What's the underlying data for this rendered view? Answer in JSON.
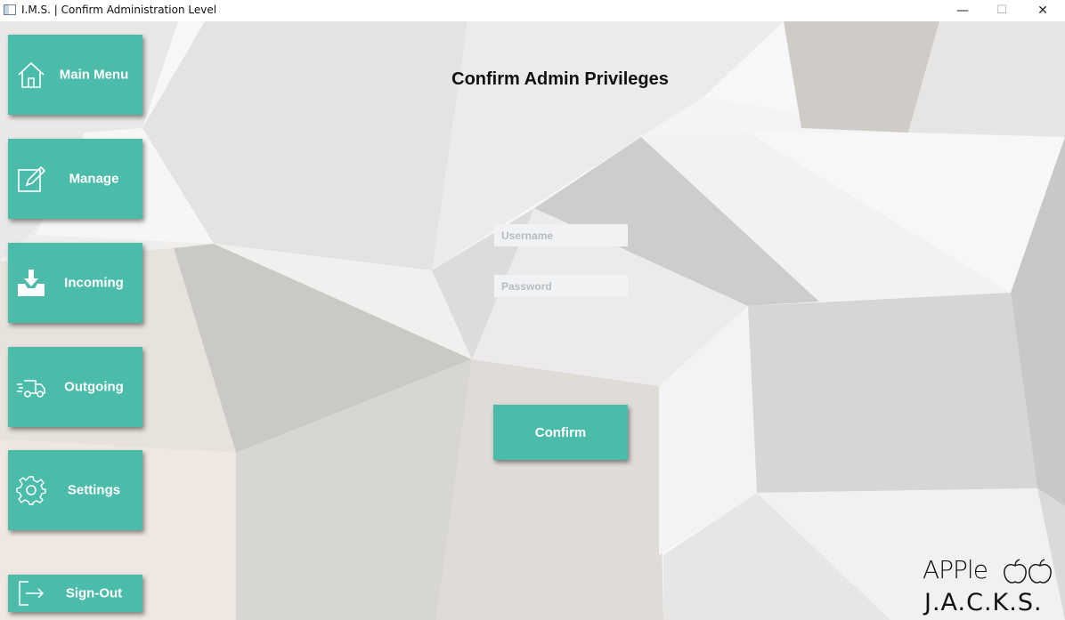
{
  "window": {
    "title": "I.M.S. | Confirm Administration Level",
    "minimize": "—",
    "maximize": "☐",
    "close": "✕"
  },
  "sidebar": {
    "items": [
      {
        "label": "Main Menu",
        "icon": "home-icon"
      },
      {
        "label": "Manage",
        "icon": "edit-icon"
      },
      {
        "label": "Incoming",
        "icon": "inbox-download-icon"
      },
      {
        "label": "Outgoing",
        "icon": "truck-icon"
      },
      {
        "label": "Settings",
        "icon": "gear-icon"
      },
      {
        "label": "Sign-Out",
        "icon": "sign-out-icon"
      }
    ]
  },
  "main": {
    "heading": "Confirm Admin Privileges",
    "username": {
      "placeholder": "Username",
      "value": ""
    },
    "password": {
      "placeholder": "Password",
      "value": ""
    },
    "confirm_label": "Confirm"
  },
  "logo": {
    "line1": "APPle",
    "line2": "J.A.C.K.S."
  },
  "colors": {
    "accent": "#4cbcaa",
    "text": "#111111",
    "field_bg": "#f1f2f4"
  }
}
